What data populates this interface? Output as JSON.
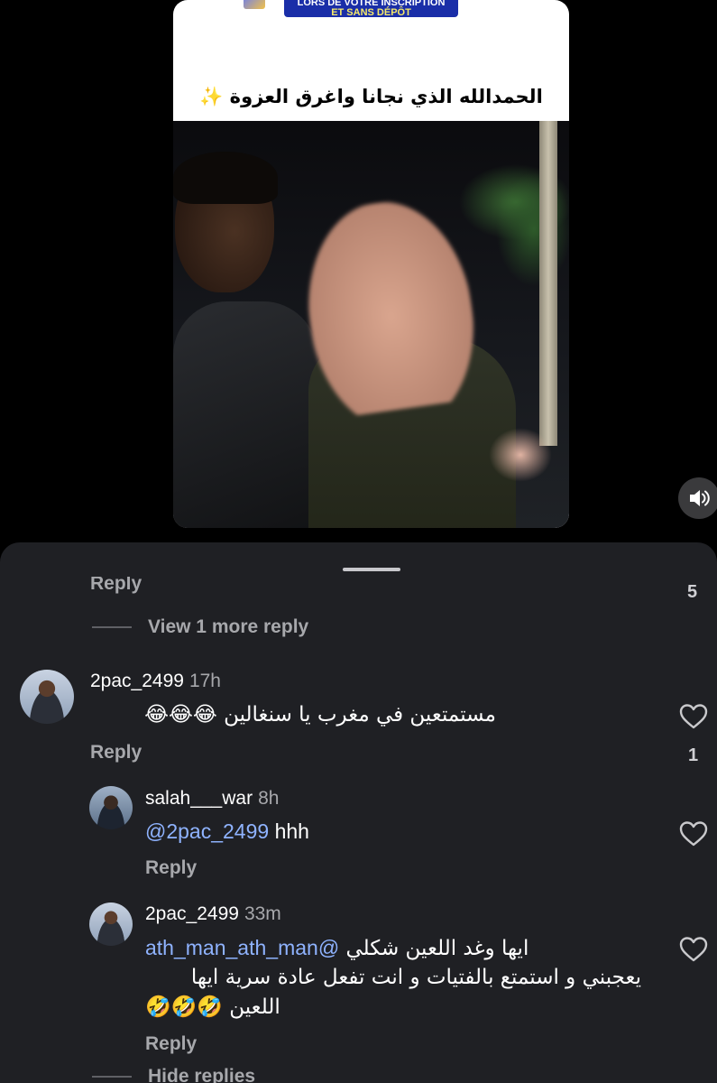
{
  "video": {
    "banner_top": "LORS DE VOTRE INSCRIPTION",
    "banner_bottom": "ET SANS DÉPÔT",
    "caption": "الحمدالله الذي نجانا واغرق العزوة ✨",
    "sound_icon": "speaker-icon"
  },
  "comments": {
    "prev_reply_label": "Reply",
    "prev_like_count": "5",
    "view_more_label": "View 1 more reply",
    "hide_replies_label": "Hide replies",
    "items": [
      {
        "username": "2pac_2499",
        "time": "17h",
        "text": "مستمتعين في مغرب يا سنغالين",
        "emojis": "😂😂😂",
        "reply_label": "Reply",
        "like_count": "1"
      },
      {
        "username": "salah___war",
        "time": "8h",
        "mention": "@2pac_2499",
        "text": "hhh",
        "reply_label": "Reply"
      },
      {
        "username": "2pac_2499",
        "time": "33m",
        "mention": "@ath_man_ath_man",
        "text_line1": "ايها وغد اللعين شكلي",
        "text_line2": "يعجبني و استمتع بالفتيات و انت تفعل عادة سرية ايها",
        "text_line3": "اللعين",
        "emojis": "🤣🤣🤣",
        "reply_label": "Reply"
      }
    ]
  },
  "colors": {
    "sheet_bg": "#1f2024",
    "muted_text": "#a7a8ac",
    "mention": "#8fb3ff"
  }
}
